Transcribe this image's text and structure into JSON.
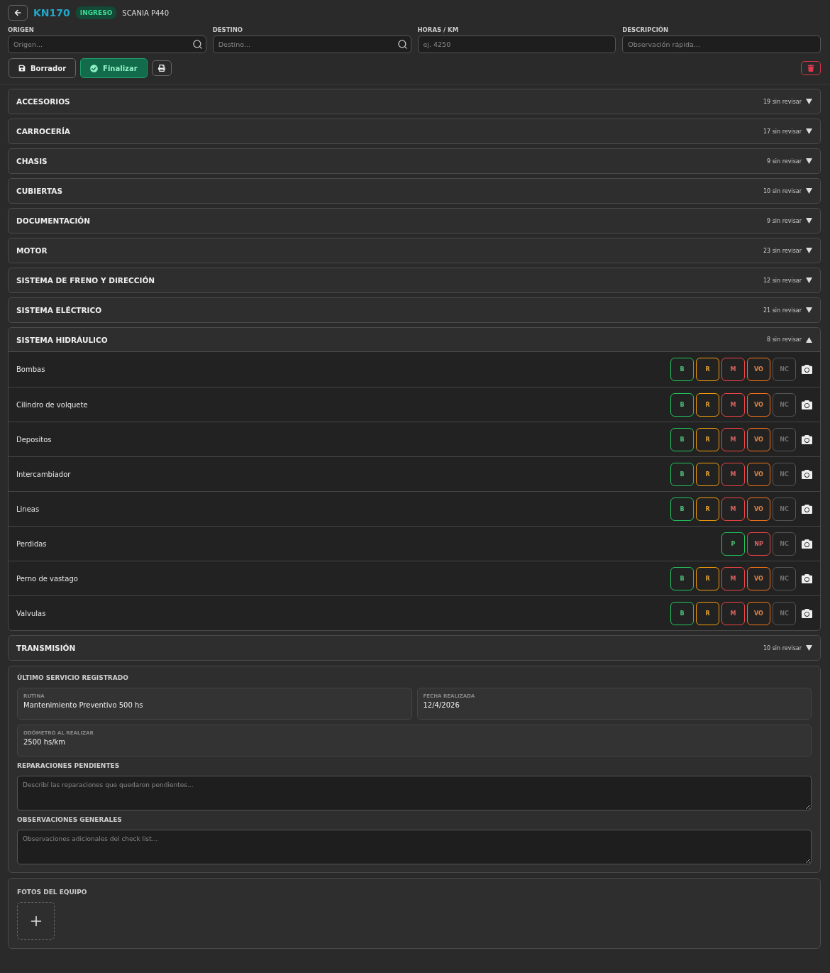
{
  "header": {
    "code": "KN170",
    "badge": "INGRESO",
    "vehicle": "SCANIA P440"
  },
  "fields": [
    {
      "label": "ORIGEN",
      "placeholder": "Origen...",
      "kind": "search"
    },
    {
      "label": "DESTINO",
      "placeholder": "Destino...",
      "kind": "search"
    },
    {
      "label": "HORAS / KM",
      "placeholder": "ej. 4250",
      "kind": "text"
    },
    {
      "label": "DESCRIPCIÓN",
      "placeholder": "Observación rápida...",
      "kind": "text"
    }
  ],
  "actions": [
    {
      "kind": "draft",
      "label": "Borrador"
    },
    {
      "kind": "finish",
      "label": "Finalizar"
    },
    {
      "kind": "print"
    },
    {
      "kind": "delete"
    }
  ],
  "sections": [
    {
      "title": "ACCESORIOS",
      "count": "19 sin revisar",
      "expanded": false
    },
    {
      "title": "CARROCERÍA",
      "count": "17 sin revisar",
      "expanded": false
    },
    {
      "title": "CHASIS",
      "count": "9 sin revisar",
      "expanded": false
    },
    {
      "title": "CUBIERTAS",
      "count": "10 sin revisar",
      "expanded": false
    },
    {
      "title": "DOCUMENTACIÓN",
      "count": "9 sin revisar",
      "expanded": false
    },
    {
      "title": "MOTOR",
      "count": "23 sin revisar",
      "expanded": false
    },
    {
      "title": "SISTEMA DE FRENO Y DIRECCIÓN",
      "count": "12 sin revisar",
      "expanded": false
    },
    {
      "title": "SISTEMA ELÉCTRICO",
      "count": "21 sin revisar",
      "expanded": false
    },
    {
      "title": "SISTEMA HIDRÁULICO",
      "count": "8 sin revisar",
      "expanded": true,
      "items": [
        {
          "name": "Bombas",
          "options": [
            {
              "label": "B",
              "color": "#22c55e"
            },
            {
              "label": "R",
              "color": "#f59e0b"
            },
            {
              "label": "M",
              "color": "#ef4444"
            },
            {
              "label": "VO",
              "color": "#f97316"
            },
            {
              "label": "NC",
              "color": "#555555"
            }
          ]
        },
        {
          "name": "Cilindro de volquete",
          "options": [
            {
              "label": "B",
              "color": "#22c55e"
            },
            {
              "label": "R",
              "color": "#f59e0b"
            },
            {
              "label": "M",
              "color": "#ef4444"
            },
            {
              "label": "VO",
              "color": "#f97316"
            },
            {
              "label": "NC",
              "color": "#555555"
            }
          ]
        },
        {
          "name": "Depositos",
          "options": [
            {
              "label": "B",
              "color": "#22c55e"
            },
            {
              "label": "R",
              "color": "#f59e0b"
            },
            {
              "label": "M",
              "color": "#ef4444"
            },
            {
              "label": "VO",
              "color": "#f97316"
            },
            {
              "label": "NC",
              "color": "#555555"
            }
          ]
        },
        {
          "name": "Intercambiador",
          "options": [
            {
              "label": "B",
              "color": "#22c55e"
            },
            {
              "label": "R",
              "color": "#f59e0b"
            },
            {
              "label": "M",
              "color": "#ef4444"
            },
            {
              "label": "VO",
              "color": "#f97316"
            },
            {
              "label": "NC",
              "color": "#555555"
            }
          ]
        },
        {
          "name": "Lineas",
          "options": [
            {
              "label": "B",
              "color": "#22c55e"
            },
            {
              "label": "R",
              "color": "#f59e0b"
            },
            {
              "label": "M",
              "color": "#ef4444"
            },
            {
              "label": "VO",
              "color": "#f97316"
            },
            {
              "label": "NC",
              "color": "#555555"
            }
          ]
        },
        {
          "name": "Perdidas",
          "options": [
            {
              "label": "P",
              "color": "#22c55e"
            },
            {
              "label": "NP",
              "color": "#ef4444"
            },
            {
              "label": "NC",
              "color": "#555555"
            }
          ]
        },
        {
          "name": "Perno de vastago",
          "options": [
            {
              "label": "B",
              "color": "#22c55e"
            },
            {
              "label": "R",
              "color": "#f59e0b"
            },
            {
              "label": "M",
              "color": "#ef4444"
            },
            {
              "label": "VO",
              "color": "#f97316"
            },
            {
              "label": "NC",
              "color": "#555555"
            }
          ]
        },
        {
          "name": "Valvulas",
          "options": [
            {
              "label": "B",
              "color": "#22c55e"
            },
            {
              "label": "R",
              "color": "#f59e0b"
            },
            {
              "label": "M",
              "color": "#ef4444"
            },
            {
              "label": "VO",
              "color": "#f97316"
            },
            {
              "label": "NC",
              "color": "#555555"
            }
          ]
        }
      ]
    },
    {
      "title": "TRANSMISIÓN",
      "count": "10 sin revisar",
      "expanded": false
    }
  ],
  "last_service": {
    "title": "ÚLTIMO SERVICIO REGISTRADO",
    "fields": [
      {
        "label": "RUTINA",
        "value": "Mantenimiento Preventivo 500 hs"
      },
      {
        "label": "FECHA REALIZADA",
        "value": "12/4/2026"
      },
      {
        "label": "ODÓMETRO AL REALIZAR",
        "value": "2500 hs/km"
      }
    ],
    "notes": [
      {
        "label": "REPARACIONES PENDIENTES",
        "placeholder": "Describí las reparaciones que quedaron pendientes..."
      },
      {
        "label": "OBSERVACIONES GENERALES",
        "placeholder": "Observaciones adicionales del check list..."
      }
    ]
  },
  "photos": {
    "title": "FOTOS DEL EQUIPO"
  }
}
